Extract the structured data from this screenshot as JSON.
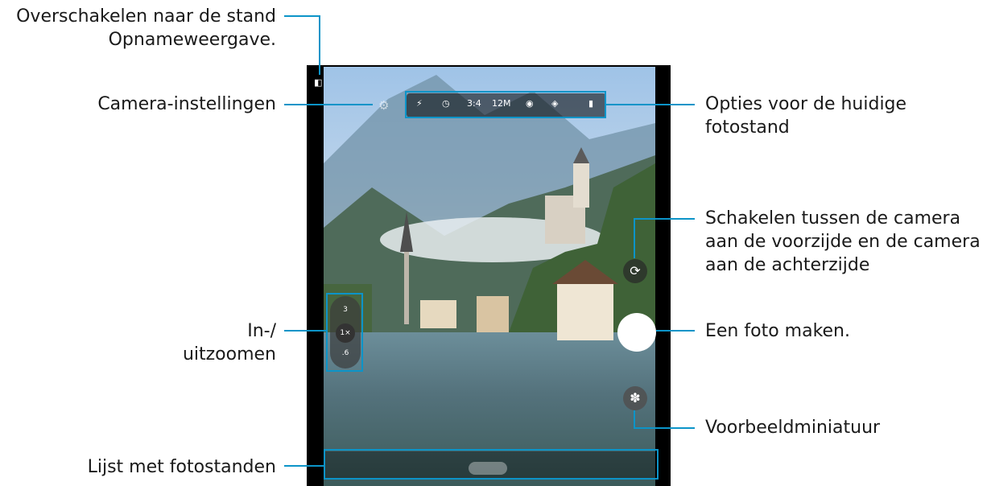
{
  "labels": {
    "switch_view": [
      "Overschakelen naar de stand",
      "Opnameweergave."
    ],
    "settings": "Camera-instellingen",
    "options": [
      "Opties voor de huidige",
      "fotostand"
    ],
    "switch_camera": [
      "Schakelen tussen de camera",
      "aan de voorzijde en de camera",
      "aan de achterzijde"
    ],
    "zoom": [
      "In-/",
      "uitzoomen"
    ],
    "take_photo": "Een foto maken.",
    "preview": "Voorbeeldminiatuur",
    "modes": "Lijst met fotostanden"
  },
  "topbar": {
    "ratio": "3:4",
    "resolution": "12M"
  },
  "zoom_levels": [
    "3",
    "1×",
    ".6"
  ],
  "colors": {
    "callout": "#0c94c8"
  }
}
